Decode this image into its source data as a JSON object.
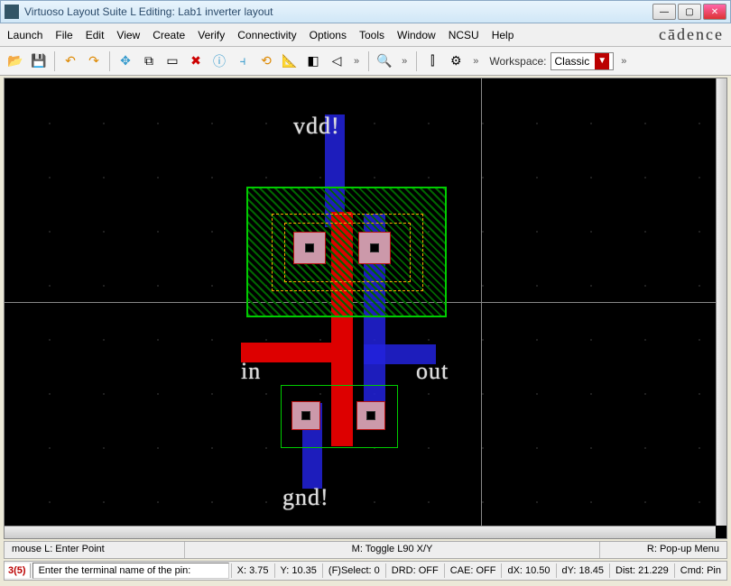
{
  "window": {
    "title": "Virtuoso Layout Suite L Editing: Lab1 inverter layout"
  },
  "menubar": {
    "items": [
      "Launch",
      "File",
      "Edit",
      "View",
      "Create",
      "Verify",
      "Connectivity",
      "Options",
      "Tools",
      "Window",
      "NCSU",
      "Help"
    ],
    "brand": "cādence"
  },
  "toolbar": {
    "workspace_label": "Workspace:",
    "workspace_value": "Classic"
  },
  "nets": {
    "vdd": "vdd!",
    "gnd": "gnd!",
    "in": "in",
    "out": "out"
  },
  "status_mouse": {
    "left": "mouse L: Enter Point",
    "mid": "M: Toggle L90 X/Y",
    "right": "R: Pop-up Menu"
  },
  "status_cmd": {
    "badge": "3(5)",
    "prompt": "Enter the terminal name of the pin:",
    "x": "X: 3.75",
    "y": "Y: 10.35",
    "fselect": "(F)Select: 0",
    "drd": "DRD: OFF",
    "cae": "CAE: OFF",
    "dx": "dX: 10.50",
    "dy": "dY: 18.45",
    "dist": "Dist: 21.229",
    "cmd": "Cmd: Pin"
  }
}
